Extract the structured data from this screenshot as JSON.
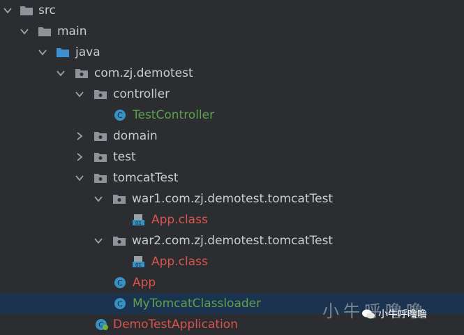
{
  "tree": [
    {
      "label": "src",
      "color": "#c9ccd1",
      "icon": "folder-icon",
      "arrow": "down",
      "depth": 0
    },
    {
      "label": "main",
      "color": "#c9ccd1",
      "icon": "folder-icon",
      "arrow": "down",
      "depth": 1
    },
    {
      "label": "java",
      "color": "#c9ccd1",
      "icon": "source-folder-icon",
      "arrow": "down",
      "depth": 2
    },
    {
      "label": "com.zj.demotest",
      "color": "#c9ccd1",
      "icon": "package-icon",
      "arrow": "down",
      "depth": 3
    },
    {
      "label": "controller",
      "color": "#c9ccd1",
      "icon": "package-icon",
      "arrow": "down",
      "depth": 4
    },
    {
      "label": "TestController",
      "color": "#5fa04e",
      "icon": "class-icon",
      "arrow": "none",
      "depth": 5
    },
    {
      "label": "domain",
      "color": "#c9ccd1",
      "icon": "package-icon",
      "arrow": "right",
      "depth": 4
    },
    {
      "label": "test",
      "color": "#c9ccd1",
      "icon": "package-icon",
      "arrow": "right",
      "depth": 4
    },
    {
      "label": "tomcatTest",
      "color": "#c9ccd1",
      "icon": "package-icon",
      "arrow": "down",
      "depth": 4
    },
    {
      "label": "war1.com.zj.demotest.tomcatTest",
      "color": "#c9ccd1",
      "icon": "package-icon",
      "arrow": "down",
      "depth": 5
    },
    {
      "label": "App.class",
      "color": "#d9534f",
      "icon": "class-file-icon",
      "arrow": "none",
      "depth": 6
    },
    {
      "label": "war2.com.zj.demotest.tomcatTest",
      "color": "#c9ccd1",
      "icon": "package-icon",
      "arrow": "down",
      "depth": 5
    },
    {
      "label": "App.class",
      "color": "#d9534f",
      "icon": "class-file-icon",
      "arrow": "none",
      "depth": 6
    },
    {
      "label": "App",
      "color": "#d9534f",
      "icon": "class-icon",
      "arrow": "none",
      "depth": 5
    },
    {
      "label": "MyTomcatClassloader",
      "color": "#5fa04e",
      "icon": "class-icon",
      "arrow": "none",
      "depth": 5,
      "selected": true
    },
    {
      "label": "DemoTestApplication",
      "color": "#d9534f",
      "icon": "spring-boot-class-icon",
      "arrow": "none",
      "depth": 4
    }
  ],
  "watermark": {
    "text": "小牛呼噜噜",
    "overlay_text": "小牛呼噜噜",
    "logo_icon": "wechat-icon"
  }
}
